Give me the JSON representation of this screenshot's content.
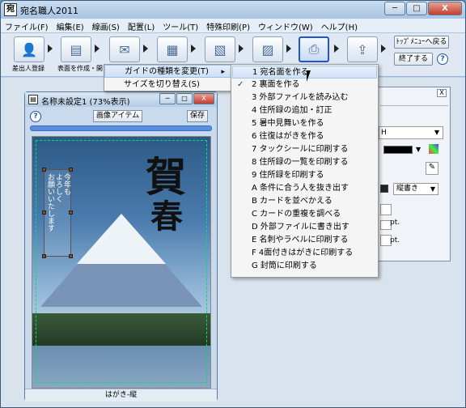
{
  "window": {
    "title": "宛名職人2011",
    "min": "─",
    "max": "□",
    "close": "X"
  },
  "menu": [
    "ファイル(F)",
    "編集(E)",
    "線画(S)",
    "配置(L)",
    "ツール(T)",
    "特殊印刷(P)",
    "ウィンドウ(W)",
    "ヘルプ(H)"
  ],
  "toolbar": {
    "labels": [
      "差出人登録",
      "表面を作成・開く"
    ],
    "top_menu_btn": "ﾄｯﾌﾟﾒﾆｭｰへ戻る",
    "exit_btn": "終了する",
    "help": "?"
  },
  "doc": {
    "title": "名称未設定1 (73%表示)",
    "image_item_btn": "画像アイテム",
    "save_btn": "保存",
    "help": "?",
    "footer": "はがき-縦",
    "kanji_top": "賀",
    "kanji_bottom": "春",
    "greeting_line1": "今年も",
    "greeting_line2": "よろしく",
    "greeting_line3": "お願いいたします"
  },
  "panel": {
    "close": "X",
    "visible_char": "H",
    "direction": "縦書き",
    "unit_1": "pt.",
    "unit_2": "pt."
  },
  "context_menu": {
    "items": [
      {
        "label": "ガイドの種類を変更(T)",
        "shortcut": "▸"
      },
      {
        "label": "サイズを切り替え(S)",
        "shortcut": ""
      }
    ]
  },
  "submenu": {
    "items": [
      "1 宛名面を作る",
      "2 裏面を作る",
      "3 外部ファイルを読み込む",
      "4 住所録の追加・訂正",
      "5 暑中見舞いを作る",
      "6 往復はがきを作る",
      "7 タックシールに印刷する",
      "8 住所録の一覧を印刷する",
      "9 住所録を印刷する",
      "A 条件に合う人を抜き出す",
      "B カードを並べかえる",
      "C カードの重複を調べる",
      "D 外部ファイルに書き出す",
      "E 名刺やラベルに印刷する",
      "F 4面付きはがきに印刷する",
      "G 封筒に印刷する"
    ],
    "checked_index": 1,
    "check_mark": "✓"
  }
}
